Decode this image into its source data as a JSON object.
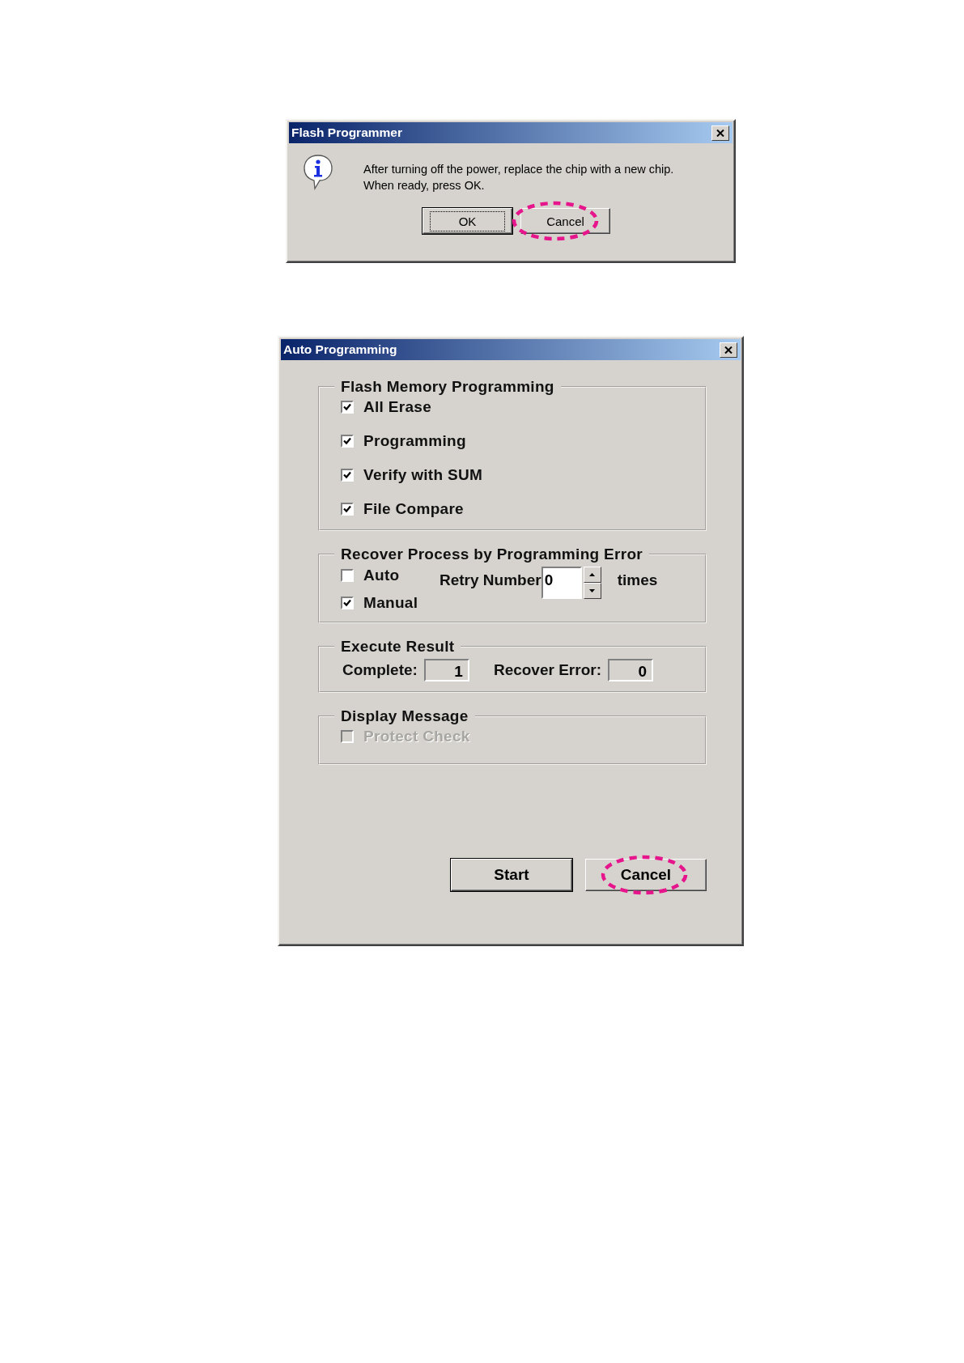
{
  "dialogs": [
    {
      "kind": "message",
      "title": "Flash Programmer",
      "message_lines": [
        "After turning off the power, replace the chip with a new chip.",
        "When ready, press OK."
      ],
      "buttons": [
        {
          "label": "OK",
          "default": true,
          "highlighted": false
        },
        {
          "label": "Cancel",
          "default": false,
          "highlighted": true
        }
      ]
    },
    {
      "kind": "form",
      "title": "Auto Programming",
      "groups": [
        {
          "kind": "checklist",
          "title": "Flash Memory Programming",
          "items": [
            {
              "label": "All Erase",
              "checked": true,
              "disabled": false
            },
            {
              "label": "Programming",
              "checked": true,
              "disabled": false
            },
            {
              "label": "Verify with SUM",
              "checked": true,
              "disabled": false
            },
            {
              "label": "File Compare",
              "checked": true,
              "disabled": false
            }
          ]
        },
        {
          "kind": "recover",
          "title": "Recover Process by Programming Error",
          "items": [
            {
              "label": "Auto",
              "checked": false,
              "disabled": false
            },
            {
              "label": "Manual",
              "checked": true,
              "disabled": false
            }
          ],
          "retry": {
            "label": "Retry Number",
            "value": "0",
            "unit": "times"
          }
        },
        {
          "kind": "results",
          "title": "Execute Result",
          "fields": [
            {
              "label": "Complete:",
              "value": "1"
            },
            {
              "label": "Recover Error:",
              "value": "0"
            }
          ]
        },
        {
          "kind": "checklist",
          "title": "Display Message",
          "items": [
            {
              "label": "Protect Check",
              "checked": false,
              "disabled": true
            }
          ]
        }
      ],
      "buttons": [
        {
          "label": "Start",
          "default": true,
          "highlighted": false
        },
        {
          "label": "Cancel",
          "default": false,
          "highlighted": true
        }
      ]
    }
  ]
}
